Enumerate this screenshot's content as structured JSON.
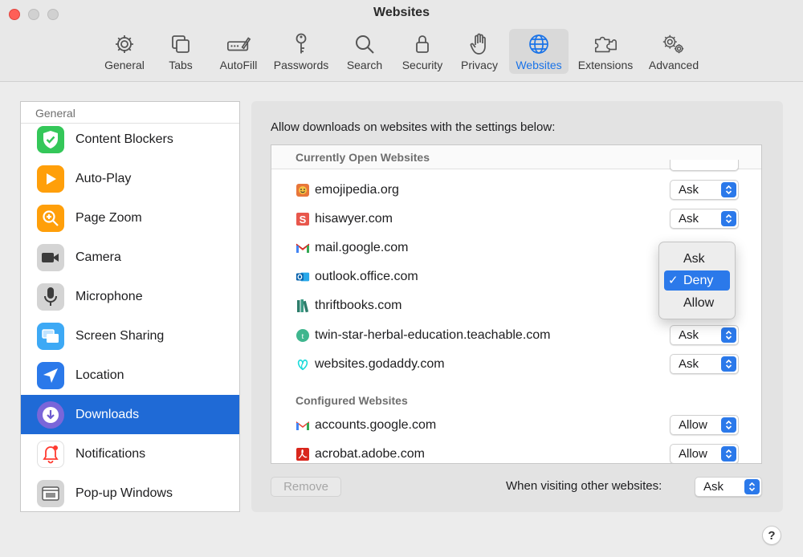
{
  "window": {
    "title": "Websites"
  },
  "toolbar": [
    {
      "label": "General",
      "icon": "gear-icon"
    },
    {
      "label": "Tabs",
      "icon": "tabs-icon"
    },
    {
      "label": "AutoFill",
      "icon": "pencil-field-icon"
    },
    {
      "label": "Passwords",
      "icon": "key-icon"
    },
    {
      "label": "Search",
      "icon": "search-icon"
    },
    {
      "label": "Security",
      "icon": "lock-icon"
    },
    {
      "label": "Privacy",
      "icon": "hand-icon"
    },
    {
      "label": "Websites",
      "icon": "globe-icon",
      "active": true
    },
    {
      "label": "Extensions",
      "icon": "puzzle-icon"
    },
    {
      "label": "Advanced",
      "icon": "gears-icon"
    }
  ],
  "sidebar": {
    "header": "General",
    "items": [
      {
        "label": "Content Blockers",
        "icon": "content-blockers-icon",
        "color": "#34c759"
      },
      {
        "label": "Auto-Play",
        "icon": "auto-play-icon",
        "color": "#ff9f0a"
      },
      {
        "label": "Page Zoom",
        "icon": "page-zoom-icon",
        "color": "#ff9f0a"
      },
      {
        "label": "Camera",
        "icon": "camera-icon",
        "color": "#5a5a5a"
      },
      {
        "label": "Microphone",
        "icon": "microphone-icon",
        "color": "#8e8e8e"
      },
      {
        "label": "Screen Sharing",
        "icon": "screen-sharing-icon",
        "color": "#3da9f5"
      },
      {
        "label": "Location",
        "icon": "location-icon",
        "color": "#2b79ea"
      },
      {
        "label": "Downloads",
        "icon": "downloads-icon",
        "color": "#6d5bd0",
        "selected": true
      },
      {
        "label": "Notifications",
        "icon": "notifications-icon",
        "color": "#ff3b30"
      },
      {
        "label": "Pop-up Windows",
        "icon": "popup-windows-icon",
        "color": "#8e8e8e"
      }
    ]
  },
  "main": {
    "caption": "Allow downloads on websites with the settings below:",
    "current_header": "Currently Open Websites",
    "configured_header": "Configured Websites",
    "current_sites": [
      {
        "site": "emojipedia.org",
        "value": "Ask",
        "favicon": "emojipedia-favicon"
      },
      {
        "site": "hisawyer.com",
        "value": "Ask",
        "favicon": "hisawyer-favicon"
      },
      {
        "site": "mail.google.com",
        "value": "",
        "favicon": "gmail-favicon"
      },
      {
        "site": "outlook.office.com",
        "value": "",
        "favicon": "outlook-favicon"
      },
      {
        "site": "thriftbooks.com",
        "value": "",
        "favicon": "thriftbooks-favicon"
      },
      {
        "site": "twin-star-herbal-education.teachable.com",
        "value": "Ask",
        "favicon": "teachable-favicon"
      },
      {
        "site": "websites.godaddy.com",
        "value": "Ask",
        "favicon": "godaddy-favicon"
      }
    ],
    "configured_sites": [
      {
        "site": "accounts.google.com",
        "value": "Allow",
        "favicon": "gmail-favicon"
      },
      {
        "site": "acrobat.adobe.com",
        "value": "Allow",
        "favicon": "adobe-favicon"
      }
    ],
    "menu": {
      "options": [
        "Ask",
        "Deny",
        "Allow"
      ],
      "checked": "Deny",
      "check_mark": "✓"
    },
    "remove_label": "Remove",
    "other_label": "When visiting other websites:",
    "other_value": "Ask"
  },
  "help_label": "?",
  "colors": {
    "accent": "#2b79ea",
    "selection": "#1f6ad6",
    "close": "#ff5f57"
  }
}
